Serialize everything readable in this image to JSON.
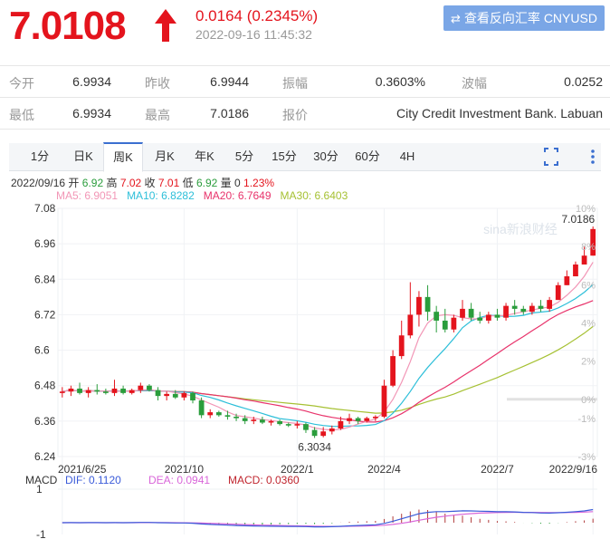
{
  "quote": {
    "price": "7.0108",
    "change": "0.0164 (0.2345%)",
    "timestamp": "2022-09-16 11:45:32",
    "reverse_button": "查看反向汇率 CNYUSD",
    "up_color": "#e4141d",
    "down_color": "#2a9d3c"
  },
  "stats": {
    "row1": [
      {
        "label": "今开",
        "value": "6.9934"
      },
      {
        "label": "昨收",
        "value": "6.9944"
      },
      {
        "label": "振幅",
        "value": "0.3603%"
      },
      {
        "label": "波幅",
        "value": "0.0252"
      }
    ],
    "row2": [
      {
        "label": "最低",
        "value": "6.9934"
      },
      {
        "label": "最高",
        "value": "7.0186"
      },
      {
        "label": "报价",
        "value": "City Credit Investment Bank. Labuan"
      }
    ]
  },
  "tabs": [
    "1分",
    "日K",
    "周K",
    "月K",
    "年K",
    "5分",
    "15分",
    "30分",
    "60分",
    "4H"
  ],
  "active_tab": "周K",
  "bar_info": {
    "date": "2022/09/16",
    "open_label": "开",
    "open": "6.92",
    "high_label": "高",
    "high": "7.02",
    "close_label": "收",
    "close": "7.01",
    "low_label": "低",
    "low": "6.92",
    "vol_label": "量",
    "vol": "0",
    "pct": "1.23%"
  },
  "ma_info": {
    "ma5": "MA5: 6.9051",
    "ma10": "MA10: 6.8282",
    "ma20": "MA20: 6.7649",
    "ma30": "MA30: 6.6403"
  },
  "macd_info": {
    "label": "MACD",
    "dif": "DIF: 0.1120",
    "dea": "DEA: 0.0941",
    "macd": "MACD: 0.0360"
  },
  "chart_data": {
    "type": "candlestick",
    "ylim": [
      6.24,
      7.08
    ],
    "y_ticks": [
      "7.08",
      "6.96",
      "6.84",
      "6.72",
      "6.6",
      "6.48",
      "6.36",
      "6.24"
    ],
    "pct_ticks": [
      "10%",
      "8%",
      "6%",
      "4%",
      "2%",
      "0%",
      "-1%",
      "-3%"
    ],
    "x_ticks": [
      {
        "label": "2021/6/25",
        "index": 0
      },
      {
        "label": "2021/10",
        "index": 14
      },
      {
        "label": "2022/1",
        "index": 27
      },
      {
        "label": "2022/4",
        "index": 37
      },
      {
        "label": "2022/7",
        "index": 50
      },
      {
        "label": "2022/9/16",
        "index": 61
      }
    ],
    "annotations": {
      "high": "7.0186",
      "low": "6.3034"
    },
    "watermark": "sina新浪财经",
    "candles": [
      {
        "o": 6.455,
        "h": 6.475,
        "l": 6.44,
        "c": 6.46
      },
      {
        "o": 6.46,
        "h": 6.48,
        "l": 6.445,
        "c": 6.47
      },
      {
        "o": 6.47,
        "h": 6.49,
        "l": 6.45,
        "c": 6.455
      },
      {
        "o": 6.455,
        "h": 6.475,
        "l": 6.44,
        "c": 6.465
      },
      {
        "o": 6.465,
        "h": 6.485,
        "l": 6.45,
        "c": 6.46
      },
      {
        "o": 6.46,
        "h": 6.47,
        "l": 6.45,
        "c": 6.455
      },
      {
        "o": 6.455,
        "h": 6.5,
        "l": 6.445,
        "c": 6.47
      },
      {
        "o": 6.47,
        "h": 6.48,
        "l": 6.45,
        "c": 6.455
      },
      {
        "o": 6.455,
        "h": 6.47,
        "l": 6.45,
        "c": 6.465
      },
      {
        "o": 6.465,
        "h": 6.49,
        "l": 6.455,
        "c": 6.48
      },
      {
        "o": 6.48,
        "h": 6.485,
        "l": 6.46,
        "c": 6.465
      },
      {
        "o": 6.465,
        "h": 6.475,
        "l": 6.43,
        "c": 6.445
      },
      {
        "o": 6.445,
        "h": 6.46,
        "l": 6.43,
        "c": 6.452
      },
      {
        "o": 6.452,
        "h": 6.465,
        "l": 6.435,
        "c": 6.44
      },
      {
        "o": 6.44,
        "h": 6.46,
        "l": 6.43,
        "c": 6.455
      },
      {
        "o": 6.455,
        "h": 6.46,
        "l": 6.42,
        "c": 6.43
      },
      {
        "o": 6.43,
        "h": 6.44,
        "l": 6.37,
        "c": 6.38
      },
      {
        "o": 6.38,
        "h": 6.4,
        "l": 6.37,
        "c": 6.39
      },
      {
        "o": 6.39,
        "h": 6.395,
        "l": 6.375,
        "c": 6.38
      },
      {
        "o": 6.38,
        "h": 6.395,
        "l": 6.365,
        "c": 6.375
      },
      {
        "o": 6.375,
        "h": 6.385,
        "l": 6.36,
        "c": 6.37
      },
      {
        "o": 6.37,
        "h": 6.38,
        "l": 6.35,
        "c": 6.36
      },
      {
        "o": 6.36,
        "h": 6.375,
        "l": 6.35,
        "c": 6.365
      },
      {
        "o": 6.365,
        "h": 6.375,
        "l": 6.35,
        "c": 6.355
      },
      {
        "o": 6.355,
        "h": 6.365,
        "l": 6.345,
        "c": 6.36
      },
      {
        "o": 6.36,
        "h": 6.365,
        "l": 6.345,
        "c": 6.35
      },
      {
        "o": 6.35,
        "h": 6.355,
        "l": 6.34,
        "c": 6.345
      },
      {
        "o": 6.345,
        "h": 6.36,
        "l": 6.335,
        "c": 6.35
      },
      {
        "o": 6.35,
        "h": 6.355,
        "l": 6.32,
        "c": 6.33
      },
      {
        "o": 6.33,
        "h": 6.34,
        "l": 6.303,
        "c": 6.31
      },
      {
        "o": 6.31,
        "h": 6.34,
        "l": 6.305,
        "c": 6.325
      },
      {
        "o": 6.325,
        "h": 6.345,
        "l": 6.315,
        "c": 6.335
      },
      {
        "o": 6.335,
        "h": 6.375,
        "l": 6.33,
        "c": 6.36
      },
      {
        "o": 6.36,
        "h": 6.385,
        "l": 6.35,
        "c": 6.37
      },
      {
        "o": 6.37,
        "h": 6.375,
        "l": 6.35,
        "c": 6.36
      },
      {
        "o": 6.36,
        "h": 6.375,
        "l": 6.355,
        "c": 6.37
      },
      {
        "o": 6.37,
        "h": 6.38,
        "l": 6.36,
        "c": 6.375
      },
      {
        "o": 6.375,
        "h": 6.5,
        "l": 6.37,
        "c": 6.48
      },
      {
        "o": 6.48,
        "h": 6.6,
        "l": 6.475,
        "c": 6.58
      },
      {
        "o": 6.58,
        "h": 6.7,
        "l": 6.57,
        "c": 6.65
      },
      {
        "o": 6.65,
        "h": 6.83,
        "l": 6.64,
        "c": 6.72
      },
      {
        "o": 6.72,
        "h": 6.8,
        "l": 6.68,
        "c": 6.78
      },
      {
        "o": 6.78,
        "h": 6.82,
        "l": 6.7,
        "c": 6.73
      },
      {
        "o": 6.73,
        "h": 6.75,
        "l": 6.66,
        "c": 6.7
      },
      {
        "o": 6.7,
        "h": 6.74,
        "l": 6.66,
        "c": 6.67
      },
      {
        "o": 6.67,
        "h": 6.72,
        "l": 6.66,
        "c": 6.71
      },
      {
        "o": 6.71,
        "h": 6.77,
        "l": 6.7,
        "c": 6.74
      },
      {
        "o": 6.74,
        "h": 6.76,
        "l": 6.7,
        "c": 6.71
      },
      {
        "o": 6.71,
        "h": 6.73,
        "l": 6.69,
        "c": 6.7
      },
      {
        "o": 6.7,
        "h": 6.73,
        "l": 6.69,
        "c": 6.72
      },
      {
        "o": 6.72,
        "h": 6.74,
        "l": 6.7,
        "c": 6.71
      },
      {
        "o": 6.71,
        "h": 6.76,
        "l": 6.7,
        "c": 6.75
      },
      {
        "o": 6.75,
        "h": 6.77,
        "l": 6.72,
        "c": 6.74
      },
      {
        "o": 6.74,
        "h": 6.75,
        "l": 6.72,
        "c": 6.73
      },
      {
        "o": 6.73,
        "h": 6.76,
        "l": 6.72,
        "c": 6.75
      },
      {
        "o": 6.75,
        "h": 6.77,
        "l": 6.73,
        "c": 6.74
      },
      {
        "o": 6.74,
        "h": 6.78,
        "l": 6.73,
        "c": 6.77
      },
      {
        "o": 6.77,
        "h": 6.83,
        "l": 6.77,
        "c": 6.82
      },
      {
        "o": 6.82,
        "h": 6.87,
        "l": 6.82,
        "c": 6.85
      },
      {
        "o": 6.85,
        "h": 6.9,
        "l": 6.85,
        "c": 6.89
      },
      {
        "o": 6.89,
        "h": 6.95,
        "l": 6.9,
        "c": 6.92
      },
      {
        "o": 6.92,
        "h": 7.0186,
        "l": 6.92,
        "c": 7.01
      }
    ],
    "ma_colors": {
      "ma5": "#f296b6",
      "ma10": "#2dbfd9",
      "ma20": "#e8336b",
      "ma30": "#a6c133"
    },
    "macd": {
      "ylim": [
        -1,
        1
      ],
      "y_ticks": [
        "1",
        "-1"
      ],
      "dif_color": "#3a5bd9",
      "dea_color": "#d966d9"
    }
  }
}
